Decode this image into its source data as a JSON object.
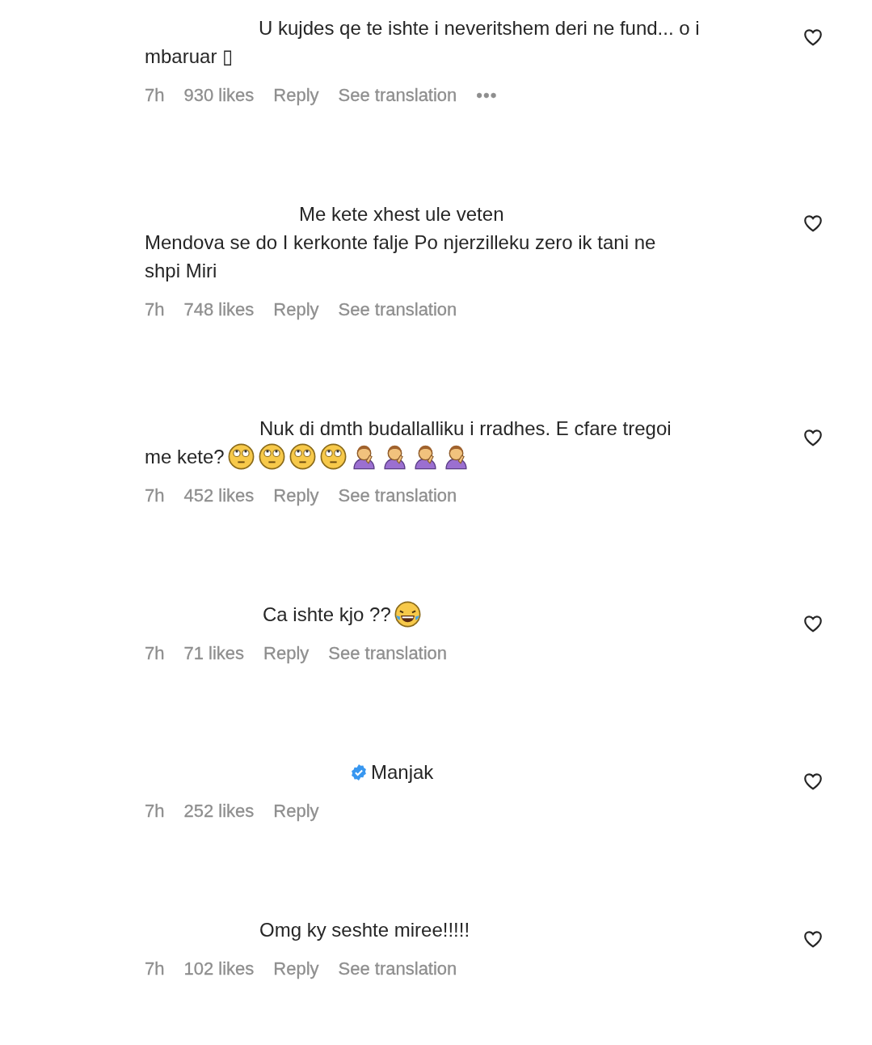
{
  "comments": [
    {
      "lines": [
        "U kujdes qe te ishte i neveritshem deri ne fund... o i",
        "mbaruar ▯"
      ],
      "time": "7h",
      "likes": "930 likes",
      "reply": "Reply",
      "translation": "See translation",
      "more": "•••",
      "liked": false
    },
    {
      "lines": [
        "Me kete xhest ule veten",
        "Mendova se do I kerkonte falje Po njerzilleku zero ik tani ne",
        "shpi Miri"
      ],
      "time": "7h",
      "likes": "748 likes",
      "reply": "Reply",
      "translation": "See translation",
      "liked": false
    },
    {
      "lines": [
        "Nuk di dmth budallalliku i rradhes. E cfare tregoi",
        "me kete?"
      ],
      "emojis": [
        {
          "kind": "eyeroll"
        },
        {
          "kind": "eyeroll"
        },
        {
          "kind": "eyeroll"
        },
        {
          "kind": "eyeroll"
        },
        {
          "kind": "facepalm"
        },
        {
          "kind": "facepalm"
        },
        {
          "kind": "facepalm"
        },
        {
          "kind": "facepalm"
        }
      ],
      "time": "7h",
      "likes": "452 likes",
      "reply": "Reply",
      "translation": "See translation",
      "liked": false
    },
    {
      "lines": [
        "Ca ishte kjo ??"
      ],
      "emojis": [
        {
          "kind": "laughing"
        }
      ],
      "time": "7h",
      "likes": "71 likes",
      "reply": "Reply",
      "translation": "See translation",
      "liked": false
    },
    {
      "lines": [
        "Manjak"
      ],
      "verified": true,
      "time": "7h",
      "likes": "252 likes",
      "reply": "Reply",
      "liked": false
    },
    {
      "lines": [
        "Omg ky seshte miree!!!!!"
      ],
      "time": "7h",
      "likes": "102 likes",
      "reply": "Reply",
      "translation": "See translation",
      "liked": false
    }
  ]
}
